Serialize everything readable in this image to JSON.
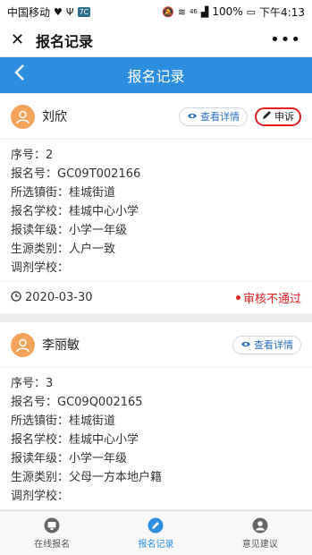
{
  "status_bar": {
    "carrier": "中国移动",
    "badge": "7C",
    "signal_text": "46",
    "battery": "100%",
    "time": "下午4:13"
  },
  "wechat_bar": {
    "close_icon": "close-icon",
    "title": "报名记录",
    "more_icon": "more-icon"
  },
  "header": {
    "back_icon": "back-chevron-icon",
    "title": "报名记录"
  },
  "colors": {
    "primary": "#2d8ee0",
    "danger": "#e02020",
    "avatar": "#f4a45a"
  },
  "records": [
    {
      "name": "刘欣",
      "detail_label": "查看详情",
      "appeal_label": "申诉",
      "rows": [
        "序号：2",
        "报名号：GC09T002166",
        "所选镇街：桂城街道",
        "报名学校：桂城中心小学",
        "报读年级：小学一年级",
        "生源类别：人户一致",
        "调剂学校："
      ],
      "date": "2020-03-30",
      "status": "审核不通过"
    },
    {
      "name": "李丽敏",
      "detail_label": "查看详情",
      "rows": [
        "序号：3",
        "报名号：GC09Q002165",
        "所选镇街：桂城街道",
        "报名学校：桂城中心小学",
        "报读年级：小学一年级",
        "生源类别：父母一方本地户籍",
        "调剂学校："
      ]
    }
  ],
  "tabs": [
    {
      "label": "在线报名",
      "icon": "monitor-icon"
    },
    {
      "label": "报名记录",
      "icon": "pencil-circle-icon",
      "active": true
    },
    {
      "label": "意见建议",
      "icon": "person-circle-icon"
    }
  ]
}
